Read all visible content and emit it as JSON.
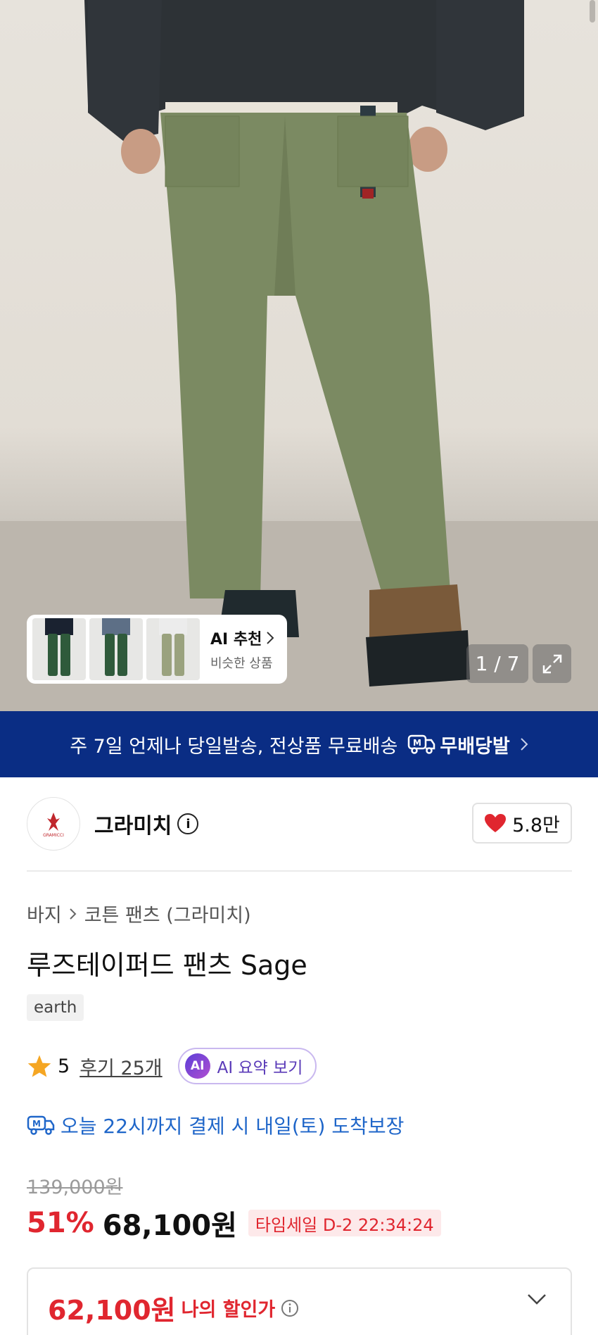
{
  "hero": {
    "ai_card": {
      "title": "AI 추천",
      "subtitle": "비슷한 상품"
    },
    "page_indicator": "1 / 7"
  },
  "banner": {
    "text": "주 7일 언제나 당일발송, 전상품 무료배송",
    "brand": "무배당발"
  },
  "brand": {
    "name": "그라미치",
    "likes": "5.8만",
    "logo_text": "GRAMICCI"
  },
  "breadcrumb": {
    "level1": "바지",
    "level2": "코튼 팬츠 (그라미치)"
  },
  "product": {
    "title": "루즈테이퍼드 팬츠 Sage",
    "tag": "earth"
  },
  "rating": {
    "score": "5",
    "reviews": "후기 25개",
    "ai_summary": "AI 요약 보기",
    "ai_badge": "AI"
  },
  "delivery": {
    "text": "오늘 22시까지 결제 시 내일(토) 도착보장"
  },
  "price": {
    "original": "139,000원",
    "discount": "51%",
    "sale": "68,100원",
    "timesale": "타임세일 D-2 22:34:24",
    "my_price": "62,100원",
    "my_price_label": "나의 할인가"
  },
  "colors": {
    "banner": "#0a2d84",
    "sale_red": "#e0262f",
    "delivery_blue": "#1f66c9",
    "ai_purple": "#5a3ab8"
  }
}
